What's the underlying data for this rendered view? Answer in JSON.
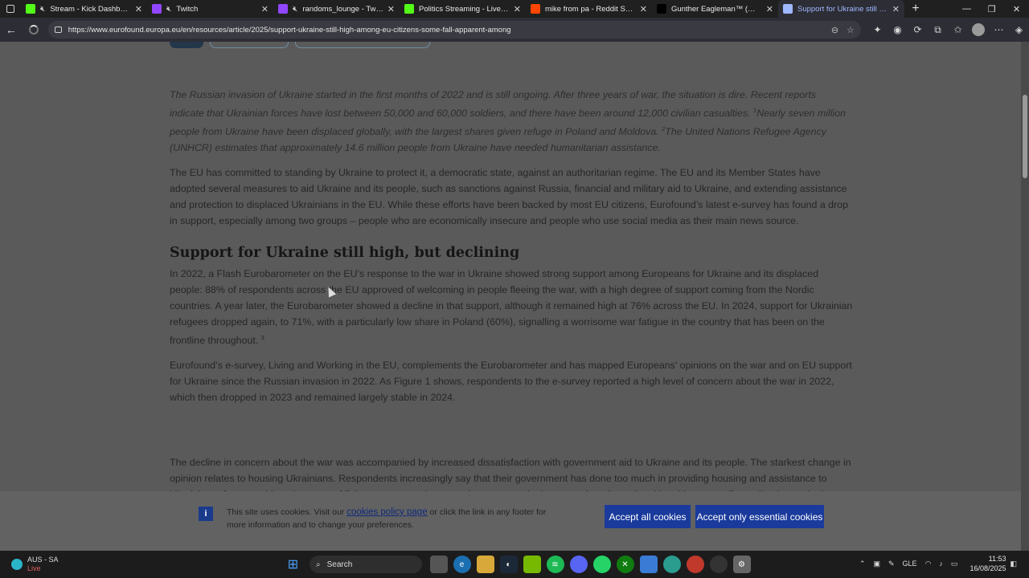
{
  "tabs": [
    {
      "title": "Stream - Kick Dashboard",
      "favicon": "kick-icon",
      "color": "#53fc18",
      "muted": true,
      "active": false
    },
    {
      "title": "Twitch",
      "favicon": "twitch-icon",
      "color": "#9146ff",
      "muted": true,
      "active": false
    },
    {
      "title": "randoms_lounge - Twitch",
      "favicon": "twitch-icon",
      "color": "#9146ff",
      "muted": true,
      "active": false
    },
    {
      "title": "Politics Streaming - Live Streams",
      "favicon": "kick-icon",
      "color": "#53fc18",
      "muted": false,
      "active": false
    },
    {
      "title": "mike from pa - Reddit Search!",
      "favicon": "reddit-icon",
      "color": "#ff4500",
      "muted": false,
      "active": false
    },
    {
      "title": "Gunther Eagleman™ (@GuntherE",
      "favicon": "x-icon",
      "color": "#000000",
      "muted": false,
      "active": false
    },
    {
      "title": "Support for Ukraine still high am",
      "favicon": "loading-icon",
      "color": "#9fb8ff",
      "muted": false,
      "active": true
    }
  ],
  "address": {
    "url": "https://www.eurofound.europa.eu/en/resources/article/2025/support-ukraine-still-high-among-eu-citizens-some-fall-apparent-among"
  },
  "article": {
    "lead_1": "The Russian invasion of Ukraine started in the first months of 2022 and is still ongoing. After three years of war, the situation is dire. Recent reports indicate that Ukrainian forces have lost between 50,000 and 60,000 soldiers, and there have been around 12,000 civilian casualties.",
    "lead_sup_1": "1",
    "lead_2": "Nearly seven million people from Ukraine have been displaced globally, with the largest shares given refuge in Poland and Moldova.",
    "lead_sup_2": "2",
    "lead_3": "The United Nations Refugee Agency (UNHCR) estimates that approximately 14.6 million people from Ukraine have needed humanitarian assistance.",
    "para_1": "The EU has committed to standing by Ukraine to protect it, a democratic state, against an authoritarian regime. The EU and its Member States have adopted several measures to aid Ukraine and its people, such as sanctions against Russia, financial and military aid to Ukraine, and extending assistance and protection to displaced Ukrainians in the EU. While these efforts have been backed by most EU citizens, Eurofound’s latest e-survey has found a drop in support, especially among two groups – people who are economically insecure and people who use social media as their main news source.",
    "heading": "Support for Ukraine still high, but declining",
    "para_2": "In 2022, a Flash Eurobarometer on the EU’s response to the war in Ukraine showed strong support among Europeans for Ukraine and its displaced people: 88% of respondents across the EU approved of welcoming in people fleeing the war, with a high degree of support coming from the Nordic countries. A year later, the Eurobarometer showed a decline in that support, although it remained high at 76% across the EU. In 2024, support for Ukrainian refugees dropped again, to 71%, with a particularly low share in Poland (60%), signalling a worrisome war fatigue in the country that has been on the frontline throughout.",
    "para_2_sup": "3",
    "para_3": "Eurofound’s e-survey, Living and Working in the EU, complements the Eurobarometer and has mapped Europeans’ opinions on the war and on EU support for Ukraine since the Russian invasion in 2022. As Figure 1 shows, respondents to the e-survey reported a high level of concern about the war in 2022, which then dropped in 2023 and remained largely stable in 2024.",
    "para_4": "The decline in concern about the war was accompanied by increased dissatisfaction with government aid to Ukraine and its people. The starkest change in opinion relates to housing Ukrainians. Respondents increasingly say that their government has done too much in providing housing and assistance to Ukrainian refugees, with an increase of 7.9 percentage points over the two years in the proportion of people taking this stance. Regarding humanitarian aid,"
  },
  "cookie": {
    "text_before": "This site uses cookies. Visit our",
    "link": "cookies policy page",
    "text_after": "or click the link in any footer for more information and to change your preferences.",
    "accept_all": "Accept all cookies",
    "accept_essential": "Accept only essential cookies"
  },
  "taskbar": {
    "weather_location": "AUS - SA",
    "weather_status": "Live",
    "search_placeholder": "Search",
    "language": "GLE",
    "time": "11:53",
    "date": "16/08/2025"
  }
}
